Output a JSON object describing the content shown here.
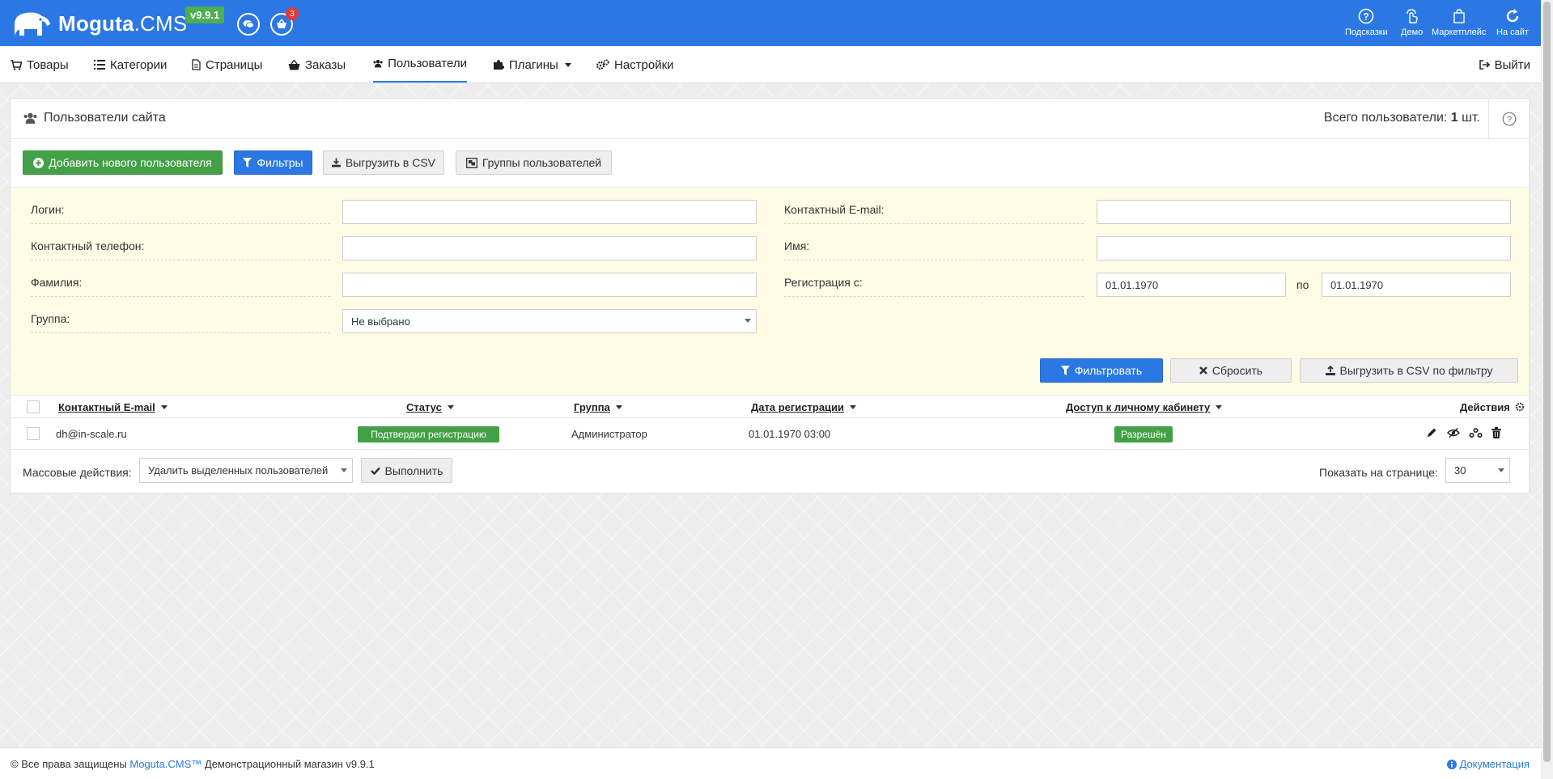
{
  "header": {
    "logo_brand": "Moguta",
    "logo_suffix": ".CMS",
    "version": "v9.9.1",
    "cart_count": "3",
    "links": [
      {
        "label": "Подсказки",
        "icon": "question-circle-icon"
      },
      {
        "label": "Демо",
        "icon": "hand-pointer-icon"
      },
      {
        "label": "Маркетплейс",
        "icon": "shopping-bag-icon"
      },
      {
        "label": "На сайт",
        "icon": "refresh-icon"
      }
    ]
  },
  "nav": {
    "items": [
      {
        "label": "Товары",
        "icon": "cart-icon"
      },
      {
        "label": "Категории",
        "icon": "list-icon"
      },
      {
        "label": "Страницы",
        "icon": "file-icon"
      },
      {
        "label": "Заказы",
        "icon": "basket-icon"
      },
      {
        "label": "Пользователи",
        "icon": "users-icon",
        "active": true
      },
      {
        "label": "Плагины",
        "icon": "puzzle-icon"
      },
      {
        "label": "Настройки",
        "icon": "cogs-icon"
      }
    ],
    "logout": "Выйти"
  },
  "panel": {
    "title": "Пользователи сайта",
    "total_label": "Всего пользователи:",
    "total_count": "1",
    "total_unit": "шт."
  },
  "toolbar": {
    "add_user": "Добавить нового пользователя",
    "filters": "Фильтры",
    "export_csv": "Выгрузить в CSV",
    "user_groups": "Группы пользователей"
  },
  "filters": {
    "login_label": "Логин:",
    "login_value": "",
    "email_label": "Контактный E-mail:",
    "email_value": "",
    "phone_label": "Контактный телефон:",
    "phone_value": "",
    "name_label": "Имя:",
    "name_value": "",
    "surname_label": "Фамилия:",
    "surname_value": "",
    "reg_label": "Регистрация с:",
    "reg_from": "01.01.1970",
    "reg_to_label": "по",
    "reg_to": "01.01.1970",
    "group_label": "Группа:",
    "group_value": "Не выбрано",
    "apply": "Фильтровать",
    "reset": "Сбросить",
    "export_filtered": "Выгрузить в CSV по фильтру"
  },
  "table": {
    "columns": {
      "email": "Контактный E-mail",
      "status": "Статус",
      "group": "Группа",
      "reg_date": "Дата регистрации",
      "access": "Доступ к личному кабинету",
      "actions": "Действия"
    },
    "rows": [
      {
        "email": "dh@in-scale.ru",
        "status": "Подтвердил регистрацию",
        "group": "Администратор",
        "reg_date": "01.01.1970 03:00",
        "access": "Разрешён"
      }
    ]
  },
  "bulk": {
    "label": "Массовые действия:",
    "selected": "Удалить выделенных пользователей",
    "execute": "Выполнить",
    "per_page_label": "Показать на странице:",
    "per_page": "30"
  },
  "footer": {
    "copyright": "© Все права защищены",
    "brand_link": "Moguta.CMS™",
    "shop_text": "Демонстрационный магазин v9.9.1",
    "docs": "Документация"
  },
  "colors": {
    "primary": "#2b78e4",
    "success": "#43a047",
    "filter_bg": "#fffbe5"
  }
}
